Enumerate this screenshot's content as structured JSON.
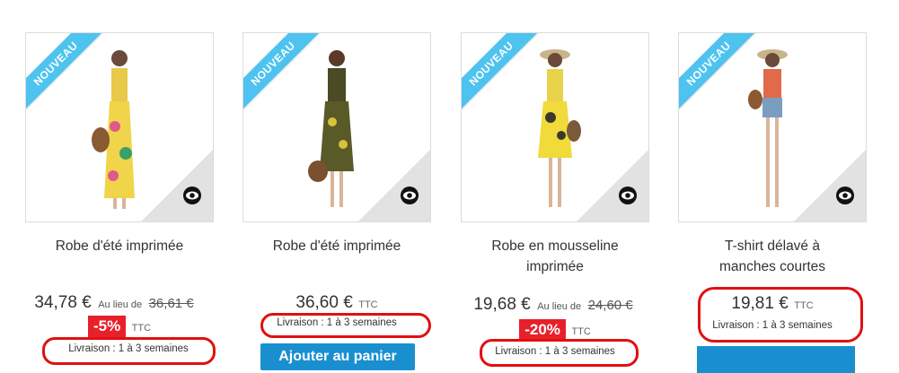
{
  "ribbon_text": "NOUVEAU",
  "labels": {
    "au_lieu_de": "Au lieu de",
    "ttc": "TTC"
  },
  "products": [
    {
      "name": "Robe d'été imprimée",
      "price": "34,78 €",
      "old_price": "36,61 €",
      "discount": "-5%",
      "delivery": "Livraison : 1 à 3 semaines"
    },
    {
      "name": "Robe d'été imprimée",
      "price": "36,60 €",
      "delivery": "Livraison : 1 à 3 semaines",
      "cart_button": "Ajouter au panier"
    },
    {
      "name_line1": "Robe en mousseline",
      "name_line2": "imprimée",
      "price": "19,68 €",
      "old_price": "24,60 €",
      "discount": "-20%",
      "delivery": "Livraison : 1 à 3 semaines"
    },
    {
      "name_line1": "T-shirt délavé à",
      "name_line2": "manches courtes",
      "price": "19,81 €",
      "delivery": "Livraison : 1 à 3 semaines"
    }
  ],
  "colors": {
    "ribbon": "#4ec3f0",
    "discount_badge": "#e8202a",
    "annotation": "#e01010",
    "button": "#1a8fd0"
  },
  "icons": [
    "quick-view-eye-icon"
  ]
}
